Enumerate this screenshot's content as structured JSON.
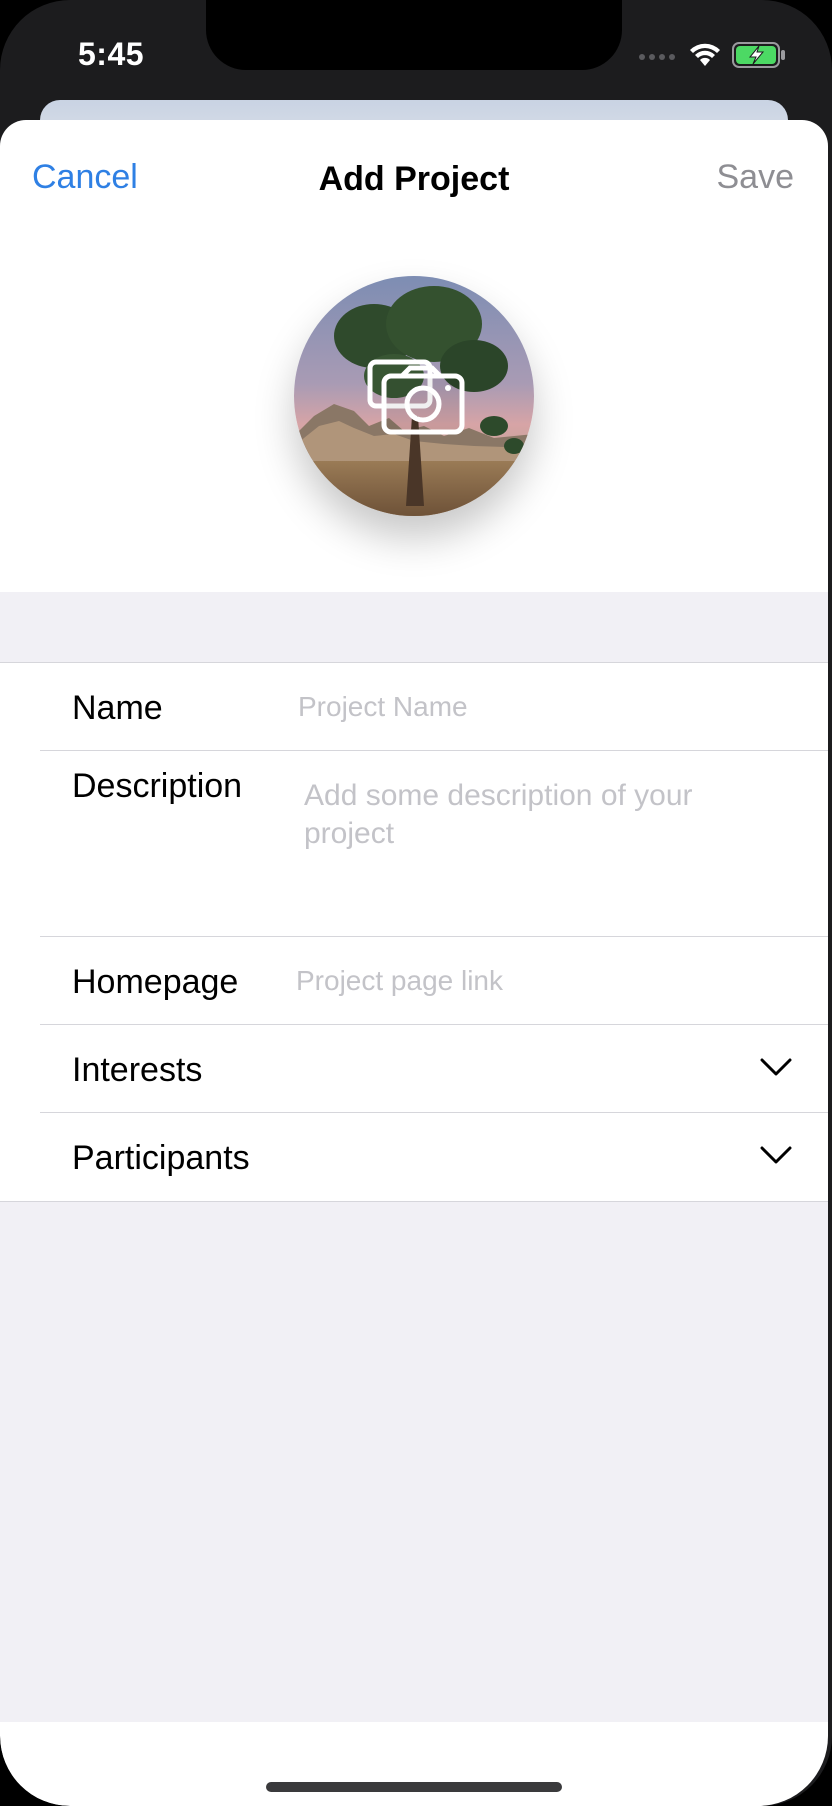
{
  "status_bar": {
    "time": "5:45",
    "icons": [
      "cellular-icon",
      "wifi-icon",
      "battery-charging-icon"
    ]
  },
  "nav": {
    "cancel_label": "Cancel",
    "title": "Add Project",
    "save_label": "Save"
  },
  "photo": {
    "icon": "camera-icon",
    "image_description": "Joshua tree at sunset"
  },
  "form": {
    "name_label": "Name",
    "name_placeholder": "Project Name",
    "description_label": "Description",
    "description_placeholder": "Add some description of your project",
    "homepage_label": "Homepage",
    "homepage_placeholder": "Project page link",
    "interests_label": "Interests",
    "participants_label": "Participants"
  },
  "colors": {
    "accent": "#2f80e4",
    "disabled": "#8e8e93",
    "placeholder": "#c3c3c8",
    "background_grey": "#f1f0f5"
  }
}
